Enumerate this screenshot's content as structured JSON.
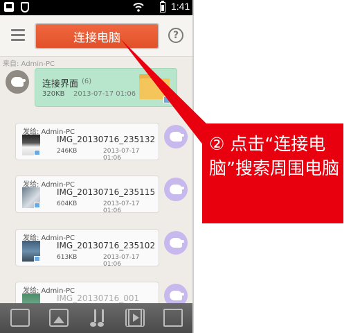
{
  "status_bar": {
    "time": "1:41"
  },
  "header": {
    "connect_button": "连接电脑"
  },
  "chat": {
    "from_top": "来自: Admin-PC",
    "folder": {
      "title": "连接界面",
      "count": "(6)",
      "size": "320KB",
      "date": "2013-07-17 01:06"
    },
    "files": [
      {
        "from": "发给: Admin-PC",
        "name": "IMG_20130716_235132",
        "size": "246KB",
        "date": "2013-07-17 01:06"
      },
      {
        "from": "发给: Admin-PC",
        "name": "IMG_20130716_235115",
        "size": "604KB",
        "date": "2013-07-17 01:06"
      },
      {
        "from": "发给: Admin-PC",
        "name": "IMG_20130716_235102",
        "size": "613KB",
        "date": "2013-07-17 01:06"
      },
      {
        "from": "发给: Admin-PC",
        "name": "IMG_20130716_001",
        "size": "",
        "date": ""
      }
    ]
  },
  "bottom_bar": {
    "icons": [
      "file-transfer-icon",
      "image-icon",
      "music-icon",
      "video-icon",
      "folder-icon"
    ]
  },
  "annotation": {
    "text": "② 点击“连接电脑”搜索周围电脑"
  },
  "colors": {
    "accent": "#e25129",
    "callout": "#e8000f",
    "folder_bubble": "#b7e6cc"
  }
}
